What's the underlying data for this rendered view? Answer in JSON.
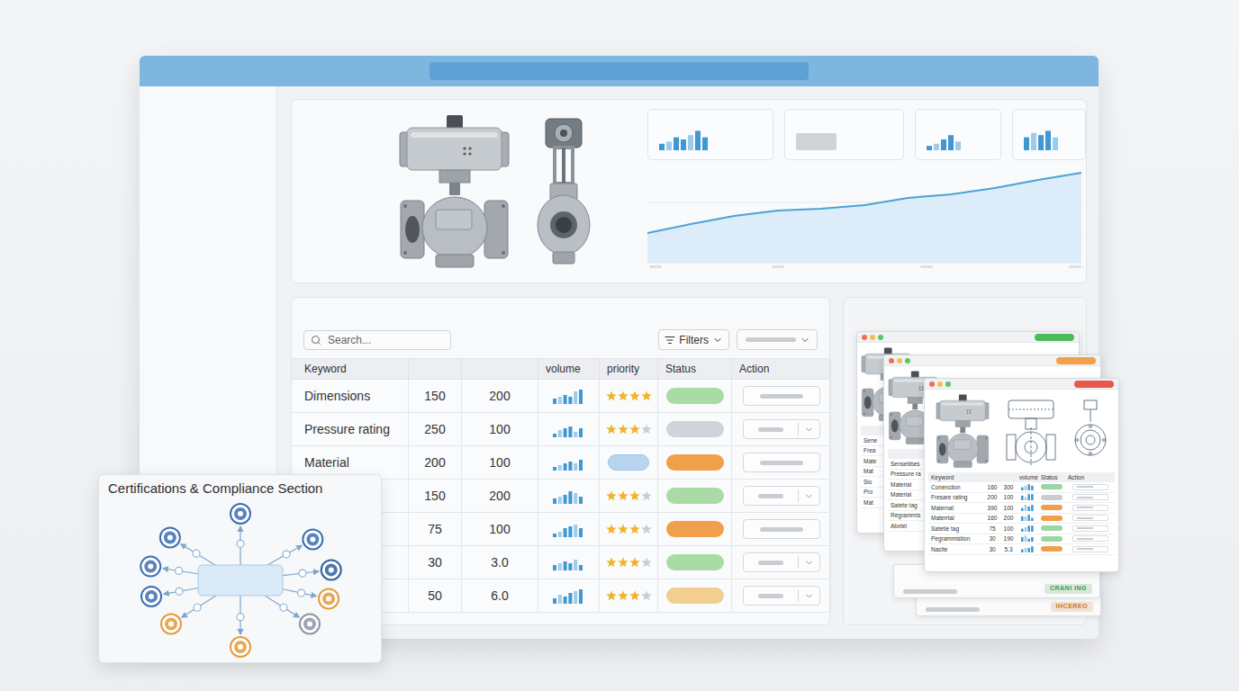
{
  "hero": {
    "stat_cards": [
      {
        "kind": "bars",
        "values": [
          3,
          4,
          6,
          5,
          7,
          9,
          6
        ]
      },
      {
        "kind": "block"
      },
      {
        "kind": "bars",
        "values": [
          2,
          3,
          5,
          7,
          4
        ]
      },
      {
        "kind": "bars",
        "values": [
          6,
          8,
          7,
          9,
          6
        ]
      }
    ],
    "trend": {
      "values": [
        35,
        45,
        54,
        60,
        62,
        66,
        74,
        78,
        85,
        94,
        102
      ]
    }
  },
  "table": {
    "search": {
      "placeholder": "Search..."
    },
    "filter_button": {
      "label": "Filters"
    },
    "columns": [
      "Keyword",
      "",
      "",
      "volume",
      "priority",
      "Status",
      "Action"
    ],
    "rows": [
      {
        "keyword": "Dimensions",
        "a": "150",
        "b": "200",
        "volume": [
          3,
          4,
          5,
          4,
          7,
          8
        ],
        "priority": {
          "kind": "stars",
          "stars": 4
        },
        "status_color": "#a9dca4",
        "action_dropdown": false
      },
      {
        "keyword": "Pressure rating",
        "a": "250",
        "b": "100",
        "volume": [
          2,
          4,
          5,
          6,
          3,
          5
        ],
        "priority": {
          "kind": "stars",
          "stars": 3
        },
        "status_color": "#cfd4da",
        "action_dropdown": true
      },
      {
        "keyword": "Material",
        "a": "200",
        "b": "100",
        "volume": [
          2,
          3,
          4,
          5,
          4,
          6
        ],
        "priority": {
          "kind": "pill",
          "color": "#b8d5f0"
        },
        "status_color": "#f0a04b",
        "action_dropdown": false
      },
      {
        "keyword": "",
        "a": "150",
        "b": "200",
        "volume": [
          3,
          4,
          5,
          7,
          6,
          4
        ],
        "priority": {
          "kind": "stars",
          "stars": 3
        },
        "status_color": "#a9dca4",
        "action_dropdown": true
      },
      {
        "keyword": "",
        "a": "75",
        "b": "100",
        "volume": [
          2,
          3,
          5,
          6,
          7,
          5
        ],
        "priority": {
          "kind": "stars",
          "stars": 3
        },
        "status_color": "#f0a04b",
        "action_dropdown": false
      },
      {
        "keyword": "",
        "a": "30",
        "b": "3.0",
        "volume": [
          3,
          4,
          5,
          4,
          6,
          3
        ],
        "priority": {
          "kind": "stars",
          "stars": 3
        },
        "status_color": "#a9dca4",
        "action_dropdown": true
      },
      {
        "keyword": "",
        "a": "50",
        "b": "6.0",
        "volume": [
          3,
          5,
          4,
          6,
          7,
          8
        ],
        "priority": {
          "kind": "stars",
          "stars": 3
        },
        "status_color": "#f3cf8f",
        "action_dropdown": true
      }
    ]
  },
  "certifications": {
    "title": "Certifications & Compliance Section",
    "badges": [
      {
        "color": "#3d6fae"
      },
      {
        "color": "#3d6fae"
      },
      {
        "color": "#2f5f9e"
      },
      {
        "color": "#e39a3b"
      },
      {
        "color": "#8c96a3"
      },
      {
        "color": "#e39a3b"
      },
      {
        "color": "#e39a3b"
      },
      {
        "color": "#3d6fae"
      },
      {
        "color": "#3d6fae"
      },
      {
        "color": "#3d6fae"
      }
    ]
  },
  "preview_stack": {
    "back_windows": [
      {
        "tag_color": "#4cbb5c",
        "labels": [
          "Sene",
          "Frea",
          "Mate",
          "Mat",
          "Sio",
          "Pro",
          "Mat"
        ]
      },
      {
        "tag_color": "#f0a04b",
        "labels": [
          "Sensebbes",
          "Pressure ra",
          "Material",
          "Material",
          "Satete tag",
          "Regrammis",
          "Abxtel"
        ]
      }
    ],
    "front_window": {
      "tag_color": "#e8574c",
      "columns": [
        "Keyword",
        "",
        "",
        "volume",
        "Status",
        "Action"
      ],
      "rows": [
        {
          "keyword": "Conenciion",
          "a": "160",
          "b": "300",
          "volume": [
            2,
            3,
            4,
            3
          ],
          "status_color": "#9bd6a0"
        },
        {
          "keyword": "Fresare rating",
          "a": "200",
          "b": "100",
          "volume": [
            3,
            2,
            4,
            4
          ],
          "status_color": "#c8cdd2"
        },
        {
          "keyword": "Malernal",
          "a": "390",
          "b": "100",
          "volume": [
            2,
            4,
            3,
            4
          ],
          "status_color": "#f0a04b"
        },
        {
          "keyword": "Materrtal",
          "a": "160",
          "b": "200",
          "volume": [
            3,
            3,
            4,
            2
          ],
          "status_color": "#f0a04b"
        },
        {
          "keyword": "Satetie tag",
          "a": "75",
          "b": "100",
          "volume": [
            2,
            3,
            4,
            4
          ],
          "status_color": "#9bd6a0"
        },
        {
          "keyword": "Pegrammistion",
          "a": "30",
          "b": "190",
          "volume": [
            3,
            4,
            2,
            3
          ],
          "status_color": "#9bd6a0"
        },
        {
          "keyword": "Nacite",
          "a": "30",
          "b": "5.3",
          "volume": [
            2,
            3,
            3,
            4
          ],
          "status_color": "#f0a04b"
        }
      ]
    },
    "sheets": [
      {
        "tag": "CRANI ING",
        "color": "#3e9b4f"
      },
      {
        "tag": "IHCEREO",
        "color": "#c9772a"
      }
    ]
  }
}
